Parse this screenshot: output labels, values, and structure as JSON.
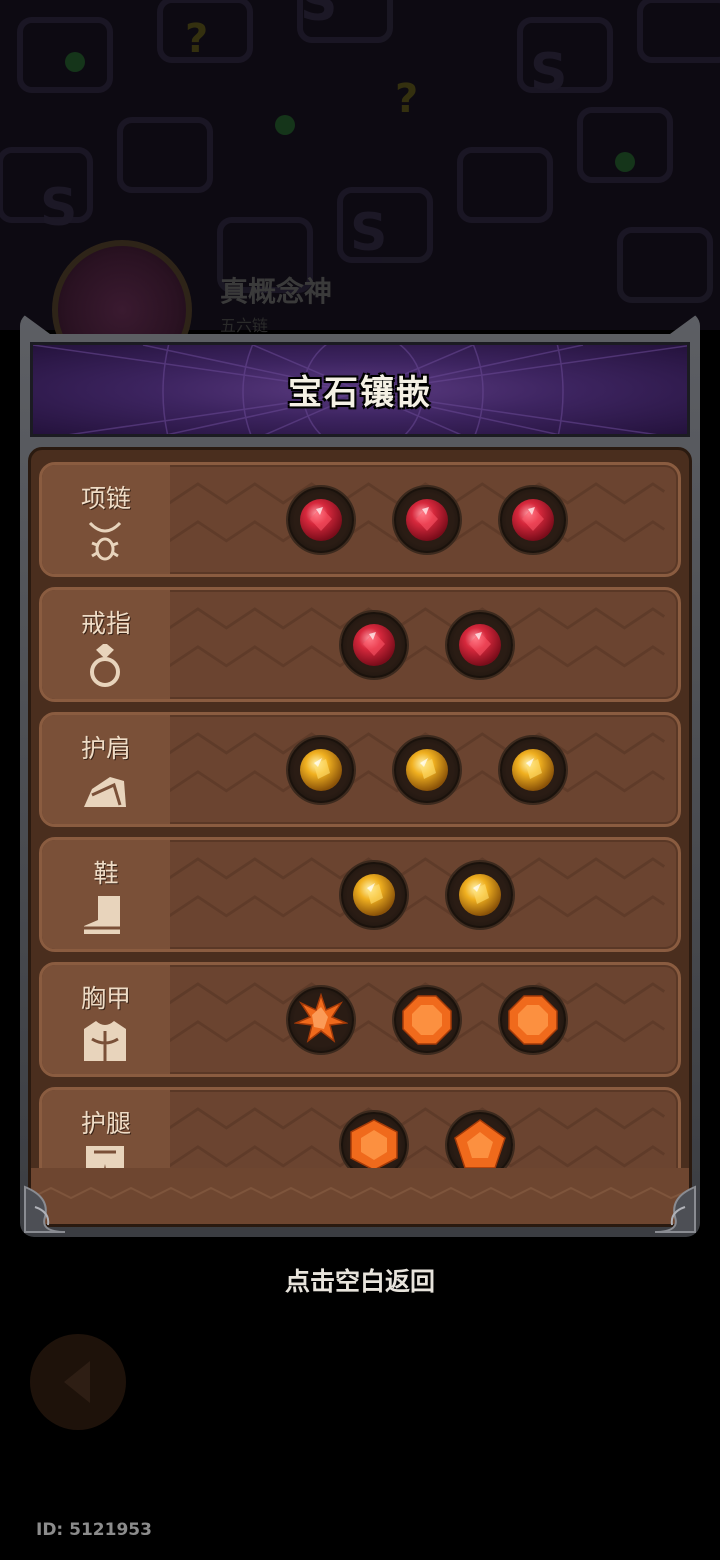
{
  "background": {
    "title": "真概念神",
    "subtitle": "五六链"
  },
  "dialog": {
    "title": "宝石镶嵌"
  },
  "equipment": [
    {
      "name": "项链",
      "icon": "necklace-icon",
      "gems": [
        "ruby",
        "ruby",
        "ruby"
      ]
    },
    {
      "name": "戒指",
      "icon": "ring-icon",
      "gems": [
        "ruby",
        "ruby"
      ]
    },
    {
      "name": "护肩",
      "icon": "shoulder-icon",
      "gems": [
        "topaz",
        "topaz",
        "topaz"
      ]
    },
    {
      "name": "鞋",
      "icon": "boots-icon",
      "gems": [
        "topaz",
        "topaz"
      ]
    },
    {
      "name": "胸甲",
      "icon": "chestplate-icon",
      "gems": [
        "orange-star",
        "orange-octagon",
        "orange-octagon"
      ]
    },
    {
      "name": "护腿",
      "icon": "leggings-icon",
      "gems": [
        "orange-hexagon",
        "orange-pentagon"
      ]
    }
  ],
  "footer": {
    "hint": "点击空白返回",
    "id_label": "ID: 5121953"
  },
  "colors": {
    "ruby": "#d6283c",
    "topaz": "#f0b020",
    "orange": "#f06a1c",
    "header_purple": "#3d2460",
    "row_brown": "#6b4430"
  }
}
